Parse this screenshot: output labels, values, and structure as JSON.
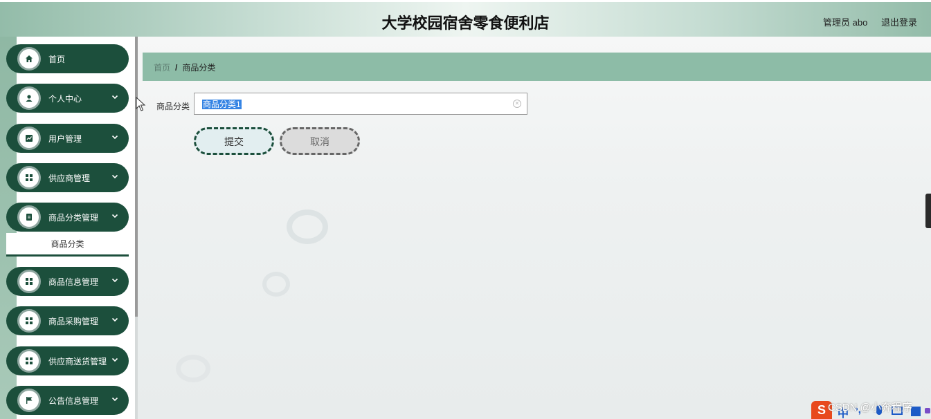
{
  "header": {
    "title": "大学校园宿舍零食便利店",
    "user": "管理员 abo",
    "logout": "退出登录"
  },
  "sidebar": {
    "items": [
      {
        "label": "首页",
        "icon": "home-icon",
        "has_chevron": false
      },
      {
        "label": "个人中心",
        "icon": "user-icon",
        "has_chevron": true
      },
      {
        "label": "用户管理",
        "icon": "chart-icon",
        "has_chevron": true
      },
      {
        "label": "供应商管理",
        "icon": "grid-icon",
        "has_chevron": true
      },
      {
        "label": "商品分类管理",
        "icon": "document-icon",
        "has_chevron": true
      },
      {
        "label": "商品信息管理",
        "icon": "grid-icon",
        "has_chevron": true
      },
      {
        "label": "商品采购管理",
        "icon": "grid-icon",
        "has_chevron": true
      },
      {
        "label": "供应商送货管理",
        "icon": "grid-icon",
        "has_chevron": true
      },
      {
        "label": "公告信息管理",
        "icon": "flag-icon",
        "has_chevron": true
      }
    ],
    "submenu_label": "商品分类"
  },
  "breadcrumb": {
    "home": "首页",
    "separator": "/",
    "current": "商品分类"
  },
  "form": {
    "label": "商品分类",
    "value": "商品分类1",
    "submit": "提交",
    "cancel": "取消"
  },
  "watermark": "CSDN @小奔程序",
  "ime": {
    "logo": "S",
    "lang": "中",
    "punct": "•,"
  },
  "colors": {
    "accent": "#1c4f3c",
    "breadcrumb_bg": "#8dbca7",
    "selection": "#3584e4"
  }
}
